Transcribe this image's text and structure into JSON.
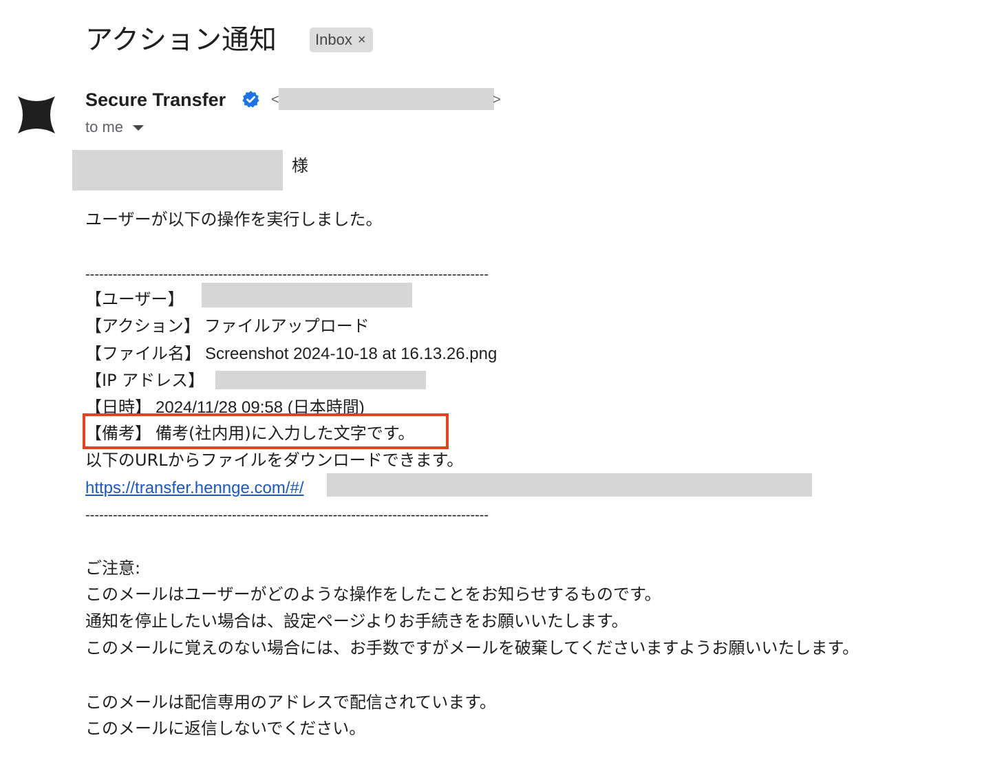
{
  "email": {
    "subject": "アクション通知",
    "label_chip": "Inbox",
    "label_close": "×",
    "sender_name": "Secure Transfer",
    "email_open": "<",
    "email_close": ">",
    "recipient": "to me",
    "salutation_suffix": "様",
    "intro": "ユーザーが以下の操作を実行しました。",
    "divider": "----------------------------------------------------------------------------------------",
    "fields": {
      "user_label": "【ユーザー】",
      "action_label": "【アクション】",
      "action_value": "ファイルアップロード",
      "filename_label": "【ファイル名】",
      "filename_value": "Screenshot 2024-10-18 at 16.13.26.png",
      "ip_label": "【IP アドレス】",
      "datetime_label": "【日時】",
      "datetime_value": "2024/11/28 09:58 (日本時間)",
      "note_label": "【備考】",
      "note_value": "備考(社内用)に入力した文字です。"
    },
    "download_text": "以下のURLからファイルをダウンロードできます。",
    "download_link": "https://transfer.hennge.com/#/",
    "notice_heading": "ご注意:",
    "notice_lines": [
      "このメールはユーザーがどのような操作をしたことをお知らせするものです。",
      "通知を停止したい場合は、設定ページよりお手続きをお願いいたします。",
      "このメールに覚えのない場合には、お手数ですがメールを破棄してくださいますようお願いいたします。"
    ],
    "footer_lines": [
      "このメールは配信専用のアドレスで配信されています。",
      "このメールに返信しないでください。"
    ]
  },
  "colors": {
    "highlight": "#e8401c",
    "link": "#1a57c8",
    "verified_badge": "#1a73e8",
    "redaction": "#d6d6d6"
  },
  "icons": {
    "avatar": "four-point-star-icon",
    "verified": "verified-badge-icon",
    "caret": "caret-down-icon",
    "chip_close": "close-icon"
  }
}
